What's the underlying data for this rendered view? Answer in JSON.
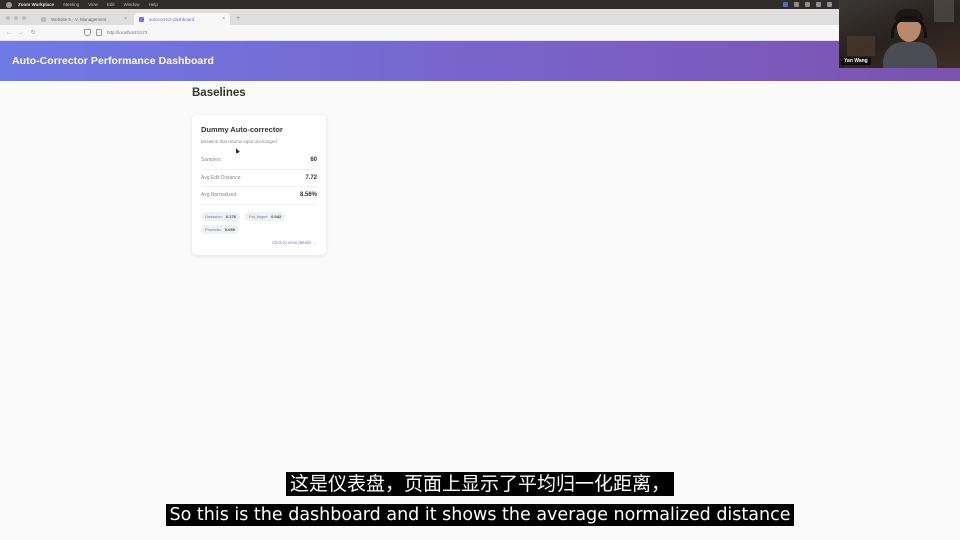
{
  "menubar": {
    "app_name": "Zoom Workplace",
    "items": [
      "Meeting",
      "View",
      "Edit",
      "Window",
      "Help"
    ]
  },
  "browser": {
    "tabs": [
      {
        "title": "Website 5 - V. Management",
        "active": false
      },
      {
        "title": "autocorrect-dashboard",
        "active": true
      }
    ],
    "new_tab": "+",
    "url": "http://localhost:5173",
    "close_glyph": "×"
  },
  "app": {
    "header_title": "Auto-Corrector Performance Dashboard",
    "section_title": "Baselines",
    "card": {
      "title": "Dummy Auto-corrector",
      "description": "Baseline that returns input unchanged",
      "stats": [
        {
          "label": "Samples:",
          "value": "60"
        },
        {
          "label": "Avg Edit Distance:",
          "value": "7.72"
        },
        {
          "label": "Avg Normalized:",
          "value": "8.56%"
        }
      ],
      "chips": [
        {
          "label": "Omission:",
          "value": "0.176"
        },
        {
          "label": "Fat_finger:",
          "value": "0.042"
        },
        {
          "label": "Phonetic:",
          "value": "0.039"
        }
      ],
      "link_text": "Click to view details →"
    }
  },
  "webcam": {
    "name": "Yan Wang"
  },
  "subtitles": {
    "zh": "这是仪表盘，页面上显示了平均归一化距离，",
    "en": "So this is the dashboard and it shows the average normalized distance"
  }
}
